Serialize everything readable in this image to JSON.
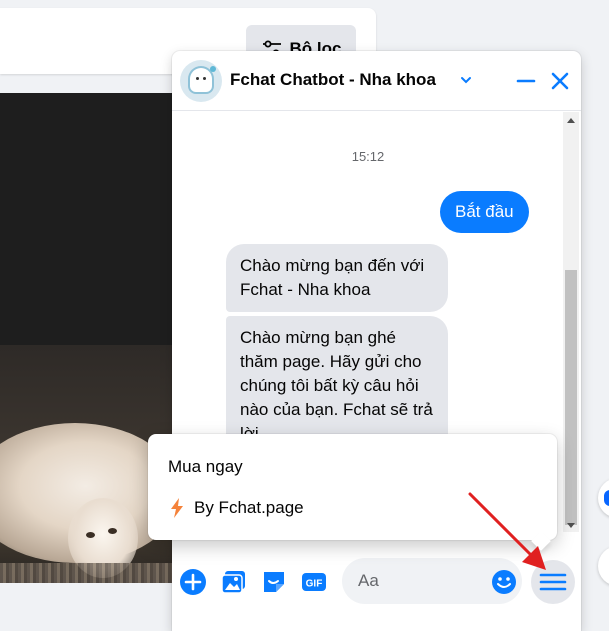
{
  "background": {
    "filter_button_label": "Bộ lọc"
  },
  "chat": {
    "title": "Fchat Chatbot - Nha khoa",
    "accent_color": "#0a7cff",
    "avatar_icon": "tooth-mascot-icon",
    "header_icons": [
      "chevron-down-icon",
      "minimize-icon",
      "close-icon"
    ],
    "messages": {
      "timestamp": "15:12",
      "outgoing": "Bắt đầu",
      "incoming_1": "Chào mừng bạn đến với Fchat - Nha khoa",
      "incoming_2": "Chào mừng bạn ghé thăm page. Hãy gửi cho chúng tôi bất kỳ câu hỏi nào của bạn. Fchat sẽ trả lời"
    },
    "popup_menu": {
      "title": "Mua ngay",
      "item_label": "By Fchat.page",
      "item_icon": "lightning-bolt-icon",
      "item_icon_color": "#f5823a"
    },
    "composer": {
      "placeholder": "Aa",
      "icons": [
        "plus-icon",
        "photo-icon",
        "sticker-icon",
        "gif-icon",
        "emoji-icon",
        "menu-icon"
      ]
    }
  },
  "annotation": {
    "arrow_color": "#e02020"
  }
}
